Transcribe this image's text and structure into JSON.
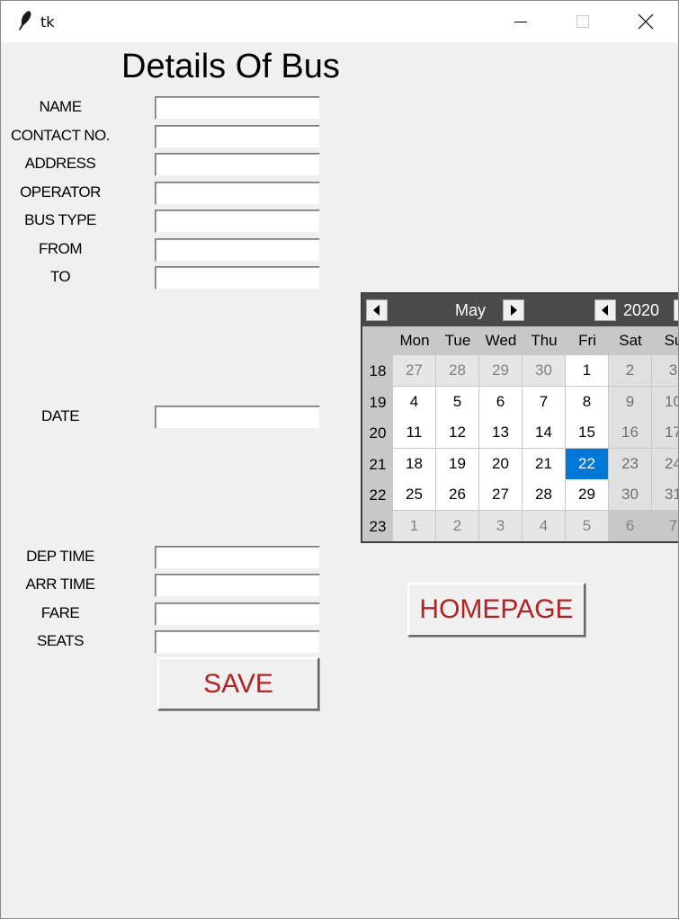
{
  "window": {
    "title": "tk"
  },
  "page_title": "Details Of Bus",
  "fields": [
    {
      "label": "NAME",
      "value": ""
    },
    {
      "label": "CONTACT NO.",
      "value": ""
    },
    {
      "label": "ADDRESS",
      "value": ""
    },
    {
      "label": "OPERATOR",
      "value": ""
    },
    {
      "label": "BUS TYPE",
      "value": ""
    },
    {
      "label": "FROM",
      "value": ""
    },
    {
      "label": "TO",
      "value": ""
    },
    {
      "label": "DATE",
      "value": ""
    },
    {
      "label": "DEP TIME",
      "value": ""
    },
    {
      "label": "ARR TIME",
      "value": ""
    },
    {
      "label": "FARE",
      "value": ""
    },
    {
      "label": "SEATS",
      "value": ""
    }
  ],
  "save_label": "SAVE",
  "homepage_label": "HOMEPAGE",
  "calendar": {
    "month": "May",
    "year": "2020",
    "weekdays": [
      "Mon",
      "Tue",
      "Wed",
      "Thu",
      "Fri",
      "Sat",
      "Su"
    ],
    "weeks": [
      {
        "num": "18",
        "days": [
          "27",
          "28",
          "29",
          "30",
          "1",
          "2",
          "3"
        ]
      },
      {
        "num": "19",
        "days": [
          "4",
          "5",
          "6",
          "7",
          "8",
          "9",
          "10"
        ]
      },
      {
        "num": "20",
        "days": [
          "11",
          "12",
          "13",
          "14",
          "15",
          "16",
          "17"
        ]
      },
      {
        "num": "21",
        "days": [
          "18",
          "19",
          "20",
          "21",
          "22",
          "23",
          "24"
        ]
      },
      {
        "num": "22",
        "days": [
          "25",
          "26",
          "27",
          "28",
          "29",
          "30",
          "31"
        ]
      },
      {
        "num": "23",
        "days": [
          "1",
          "2",
          "3",
          "4",
          "5",
          "6",
          "7"
        ]
      }
    ],
    "selected_day": "22",
    "colors": {
      "selected": "#0078d7",
      "header": "#4a4a4a",
      "weekend": "#c8c8c8",
      "othermonth": "#e6e6e6"
    }
  }
}
